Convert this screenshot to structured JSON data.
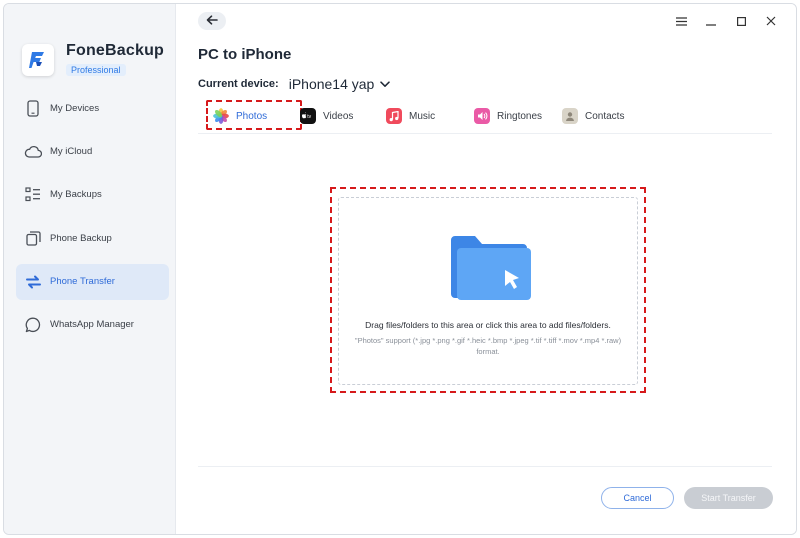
{
  "app": {
    "name": "FoneBackup",
    "edition": "Professional"
  },
  "sidebar": {
    "items": [
      {
        "label": "My Devices",
        "icon": "phone-icon",
        "active": false
      },
      {
        "label": "My iCloud",
        "icon": "cloud-icon",
        "active": false
      },
      {
        "label": "My Backups",
        "icon": "list-icon",
        "active": false
      },
      {
        "label": "Phone Backup",
        "icon": "copy-icon",
        "active": false
      },
      {
        "label": "Phone Transfer",
        "icon": "transfer-icon",
        "active": true
      },
      {
        "label": "WhatsApp Manager",
        "icon": "chat-icon",
        "active": false
      }
    ]
  },
  "header": {
    "title": "PC to iPhone",
    "device_label": "Current device:",
    "device_name": "iPhone14 yap"
  },
  "tabs": [
    {
      "label": "Photos",
      "icon": "photos-icon",
      "active": true
    },
    {
      "label": "Videos",
      "icon": "apple-tv-icon",
      "active": false
    },
    {
      "label": "Music",
      "icon": "music-icon",
      "active": false
    },
    {
      "label": "Ringtones",
      "icon": "ringtones-icon",
      "active": false
    },
    {
      "label": "Contacts",
      "icon": "contacts-icon",
      "active": false
    }
  ],
  "drop_area": {
    "instruction": "Drag files/folders to this area or click this area to add files/folders.",
    "formats": "\"Photos\" support (*.jpg *.png *.gif *.heic *.bmp *.jpeg *.tif *.tiff *.mov *.mp4 *.raw) format."
  },
  "buttons": {
    "cancel": "Cancel",
    "start": "Start Transfer"
  },
  "colors": {
    "accent": "#2f6bd8",
    "highlight": "#d6191b",
    "folder": "#4a9af2",
    "sidebar_bg": "#f3f5f8"
  }
}
